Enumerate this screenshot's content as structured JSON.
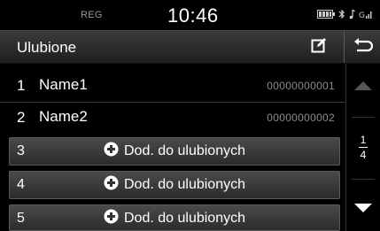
{
  "status": {
    "region": "REG",
    "time": "10:46"
  },
  "header": {
    "title": "Ulubione"
  },
  "contacts": [
    {
      "num": "1",
      "name": "Name1",
      "phone": "00000000001"
    },
    {
      "num": "2",
      "name": "Name2",
      "phone": "00000000002"
    }
  ],
  "add_rows": [
    {
      "num": "3",
      "label": "Dod. do ulubionych"
    },
    {
      "num": "4",
      "label": "Dod. do ulubionych"
    },
    {
      "num": "5",
      "label": "Dod. do ulubionych"
    }
  ],
  "pager": {
    "current": "1",
    "total": "4"
  },
  "colors": {
    "background": "#000000",
    "button": "#3a3a3a",
    "phone_text": "#8a8a8a"
  }
}
